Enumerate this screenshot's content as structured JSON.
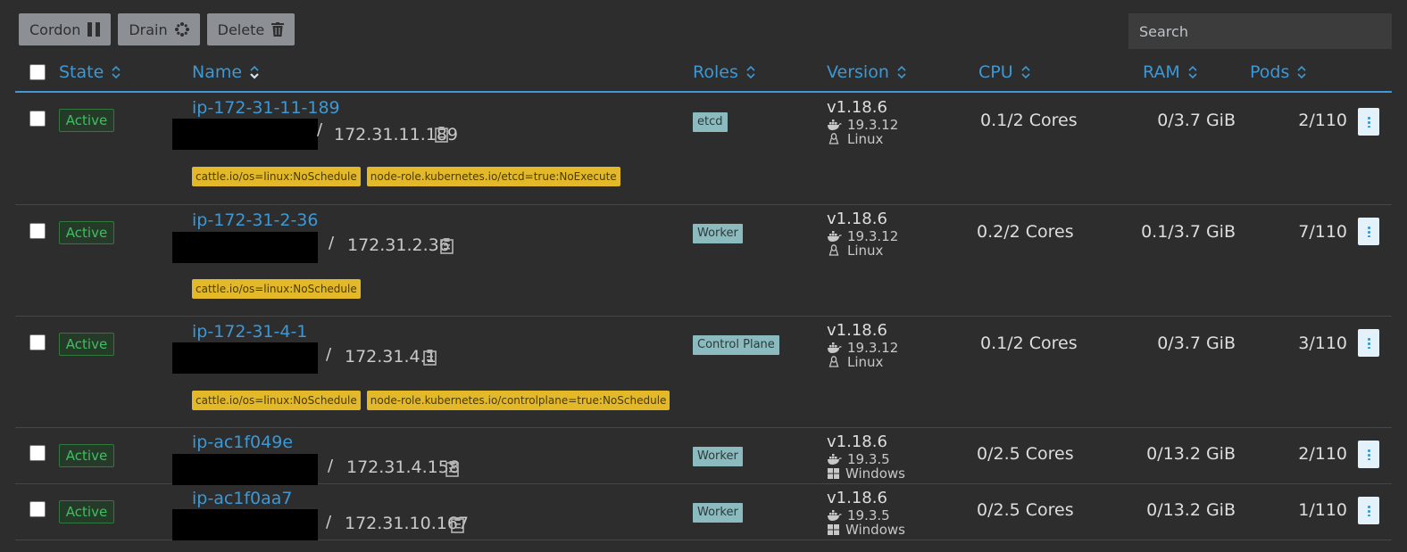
{
  "toolbar": {
    "cordon_label": "Cordon",
    "drain_label": "Drain",
    "delete_label": "Delete"
  },
  "search": {
    "placeholder": "Search"
  },
  "columns": {
    "state": "State",
    "name": "Name",
    "roles": "Roles",
    "version": "Version",
    "cpu": "CPU",
    "ram": "RAM",
    "pods": "Pods"
  },
  "nodes": [
    {
      "state": "Active",
      "name": "ip-172-31-11-189",
      "ip": "172.31.11.189",
      "taints": [
        "cattle.io/os=linux:NoSchedule",
        "node-role.kubernetes.io/etcd=true:NoExecute"
      ],
      "role": "etcd",
      "version": "v1.18.6",
      "docker": "19.3.12",
      "os": "Linux",
      "os_icon": "linux-icon",
      "cpu": "0.1/2 Cores",
      "ram": "0/3.7 GiB",
      "pods": "2/110"
    },
    {
      "state": "Active",
      "name": "ip-172-31-2-36",
      "ip": "172.31.2.36",
      "taints": [
        "cattle.io/os=linux:NoSchedule"
      ],
      "role": "Worker",
      "version": "v1.18.6",
      "docker": "19.3.12",
      "os": "Linux",
      "os_icon": "linux-icon",
      "cpu": "0.2/2 Cores",
      "ram": "0.1/3.7 GiB",
      "pods": "7/110"
    },
    {
      "state": "Active",
      "name": "ip-172-31-4-1",
      "ip": "172.31.4.1",
      "taints": [
        "cattle.io/os=linux:NoSchedule",
        "node-role.kubernetes.io/controlplane=true:NoSchedule"
      ],
      "role": "Control Plane",
      "version": "v1.18.6",
      "docker": "19.3.12",
      "os": "Linux",
      "os_icon": "linux-icon",
      "cpu": "0.1/2 Cores",
      "ram": "0/3.7 GiB",
      "pods": "3/110"
    },
    {
      "state": "Active",
      "name": "ip-ac1f049e",
      "ip": "172.31.4.158",
      "taints": [],
      "role": "Worker",
      "version": "v1.18.6",
      "docker": "19.3.5",
      "os": "Windows",
      "os_icon": "windows-icon",
      "cpu": "0/2.5 Cores",
      "ram": "0/13.2 GiB",
      "pods": "2/110"
    },
    {
      "state": "Active",
      "name": "ip-ac1f0aa7",
      "ip": "172.31.10.167",
      "taints": [],
      "role": "Worker",
      "version": "v1.18.6",
      "docker": "19.3.5",
      "os": "Windows",
      "os_icon": "windows-icon",
      "cpu": "0/2.5 Cores",
      "ram": "0/13.2 GiB",
      "pods": "1/110"
    }
  ],
  "colors": {
    "accent": "#3d98d3",
    "active_green": "#3fbf5f",
    "taint_yellow": "#e3b92a",
    "role_teal": "#8bbbbe"
  }
}
